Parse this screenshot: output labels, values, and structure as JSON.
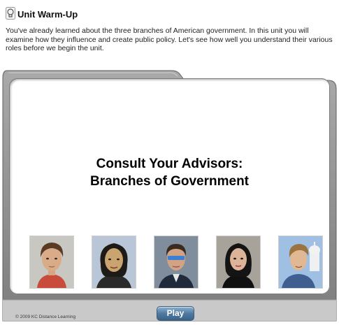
{
  "header": {
    "title": "Unit Warm-Up",
    "icon": "lightbulb-icon"
  },
  "intro": "You've already learned about the three branches of American government. In this unit you will examine how they influence and create public policy. Let's see how well you understand their various roles before we begin the unit.",
  "player": {
    "headline_line1": "Consult Your Advisors:",
    "headline_line2": "Branches of Government",
    "copyright": "© 2009 KC Distance Learning",
    "play_label": "Play",
    "colors": {
      "frame": "#8c8c8c",
      "frame_light": "#b8b8b8",
      "button": "#4f7aa0"
    }
  }
}
